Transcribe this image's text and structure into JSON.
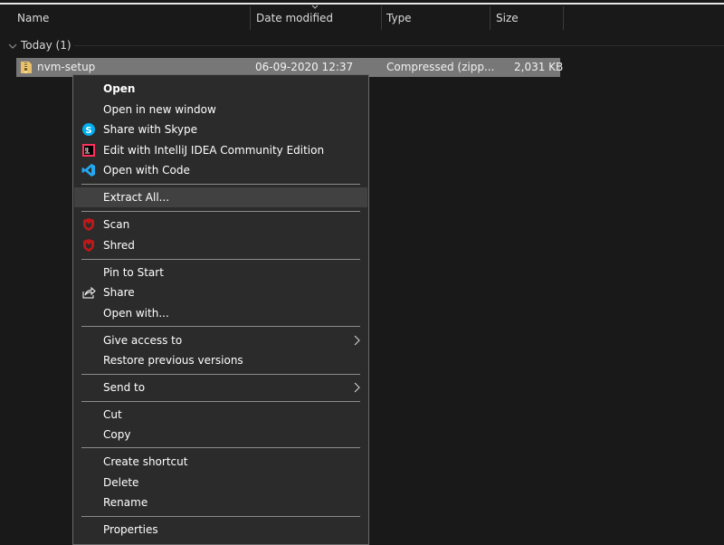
{
  "header": {
    "name": "Name",
    "date_modified": "Date modified",
    "type": "Type",
    "size": "Size"
  },
  "group": {
    "label": "Today (1)"
  },
  "file": {
    "name": "nvm-setup",
    "date": "06-09-2020 12:37",
    "type": "Compressed (zipp...",
    "size": "2,031 KB"
  },
  "menu": {
    "open": "Open",
    "open_new_window": "Open in new window",
    "share_skype": "Share with Skype",
    "edit_intellij": "Edit with IntelliJ IDEA Community Edition",
    "open_code": "Open with Code",
    "extract_all": "Extract All...",
    "scan": "Scan",
    "shred": "Shred",
    "pin_start": "Pin to Start",
    "share": "Share",
    "open_with": "Open with...",
    "give_access": "Give access to",
    "restore_versions": "Restore previous versions",
    "send_to": "Send to",
    "cut": "Cut",
    "copy": "Copy",
    "create_shortcut": "Create shortcut",
    "delete": "Delete",
    "rename": "Rename",
    "properties": "Properties"
  },
  "colors": {
    "background": "#191919",
    "menu_bg": "#2b2b2b",
    "selected_row": "#777777",
    "highlight": "#414141",
    "skype_blue": "#00aff0",
    "vscode_blue": "#23a9f2",
    "mcafee_red": "#c01818"
  },
  "icons": {
    "file": "zip-folder-icon",
    "skype": "skype-icon",
    "intellij": "intellij-icon",
    "vscode": "vscode-icon",
    "mcafee": "mcafee-shield-icon",
    "share": "share-icon",
    "submenu": "chevron-right-icon"
  }
}
